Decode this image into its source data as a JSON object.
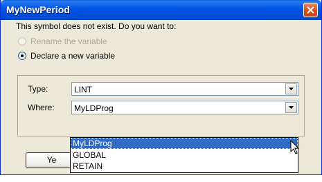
{
  "window": {
    "title": "MyNewPeriod",
    "close_icon": "close-x-icon"
  },
  "dialog": {
    "prompt": "This symbol does not exist. Do you want to:",
    "options": [
      {
        "label": "Rename the variable",
        "enabled": false,
        "checked": false
      },
      {
        "label": "Declare a new variable",
        "enabled": true,
        "checked": true
      }
    ],
    "type_label": "Type:",
    "type_value": "LINT",
    "where_label": "Where:",
    "where_value": "MyLDProg",
    "yes_button_label": "Ye"
  },
  "dropdown": {
    "items": [
      "MyLDProg",
      "GLOBAL",
      "RETAIN"
    ],
    "selected_index": 0
  },
  "colors": {
    "title_bar": "#0055e5",
    "selection": "#316ac5",
    "dialog_bg": "#ece9d8"
  }
}
